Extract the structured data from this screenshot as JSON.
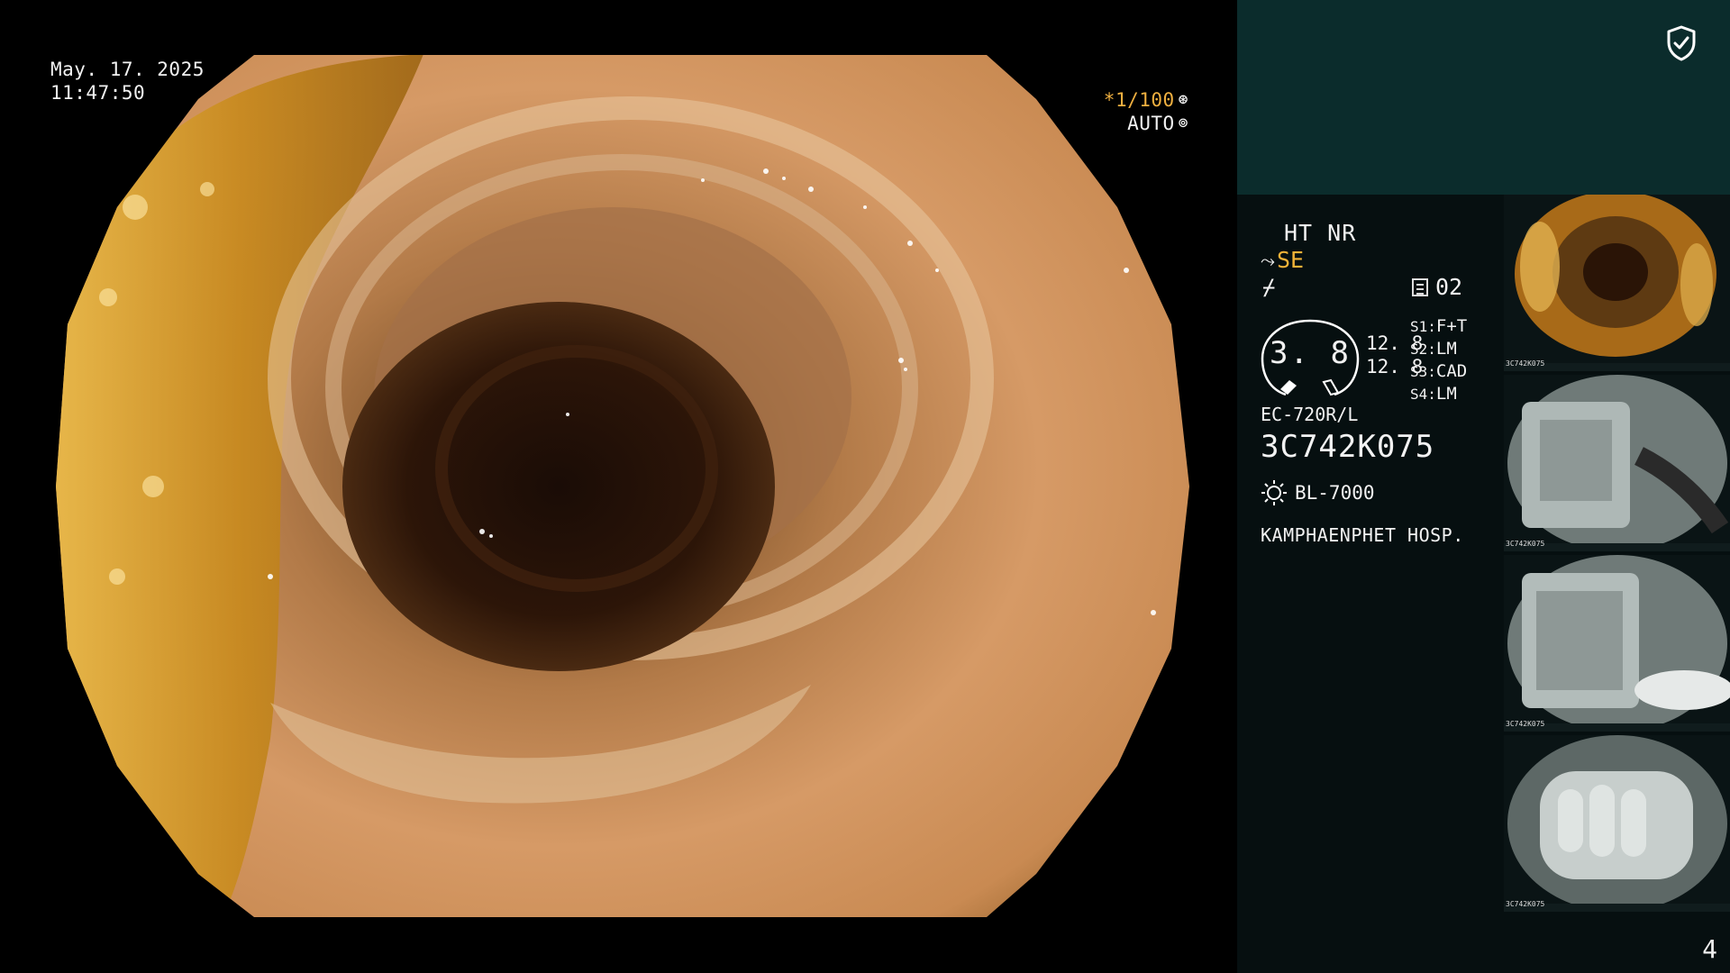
{
  "overlay": {
    "date": "May. 17. 2025",
    "time": "11:47:50",
    "shutter": "*1/100",
    "iris": "AUTO"
  },
  "panel": {
    "mode_line1": "HT NR",
    "mode_line2": "SE",
    "memory_slot": "02",
    "dial_value": "3. 8",
    "enhancement": [
      "12. 8",
      "12. 8"
    ],
    "slots": [
      {
        "key": "S1:",
        "value": "F+T"
      },
      {
        "key": "S2:",
        "value": "LM"
      },
      {
        "key": "S3:",
        "value": "CAD"
      },
      {
        "key": "S4:",
        "value": "LM"
      }
    ],
    "scope_model": "EC-720R/L",
    "scope_serial": "3C742K075",
    "light_source": "BL-7000",
    "hospital": "KAMPHAENPHET HOSP.",
    "page_number": "4"
  },
  "thumbnails": [
    {
      "name": "colon-lumen",
      "caption": "3C742K075"
    },
    {
      "name": "equipment-view-1",
      "caption": "3C742K075"
    },
    {
      "name": "equipment-view-2",
      "caption": "3C742K075"
    },
    {
      "name": "gloved-hand-view",
      "caption": "3C742K075"
    }
  ],
  "icons": {
    "shield": "shield-check-icon",
    "scope_hook": "scope-angle-icon",
    "light": "light-source-icon",
    "memo": "memory-card-icon"
  },
  "colors": {
    "panel_top": "#0b2c2c",
    "panel": "#060f10",
    "accent_orange": "#f3b238"
  }
}
